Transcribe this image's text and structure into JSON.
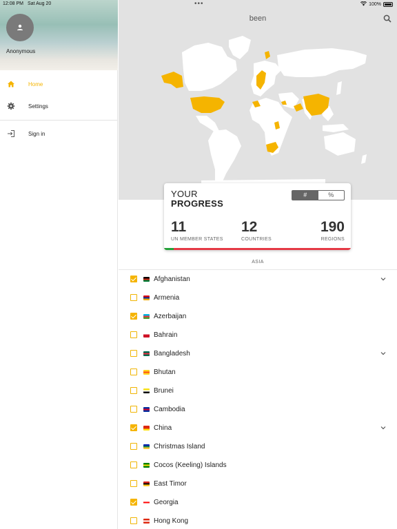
{
  "status": {
    "time": "12:08 PM",
    "date": "Sat Aug 20",
    "battery": "100%"
  },
  "sidebar": {
    "user_name": "Anonymous",
    "items": [
      {
        "label": "Home",
        "icon": "home-icon"
      },
      {
        "label": "Settings",
        "icon": "gear-icon"
      },
      {
        "label": "Sign in",
        "icon": "sign-in-icon"
      }
    ]
  },
  "app": {
    "title": "been"
  },
  "progress": {
    "title_line1": "YOUR",
    "title_line2": "PROGRESS",
    "toggle": {
      "count_label": "#",
      "percent_label": "%",
      "selected": "#"
    },
    "stats": [
      {
        "value": "11",
        "label": "UN MEMBER STATES"
      },
      {
        "value": "12",
        "label": "COUNTRIES"
      },
      {
        "value": "190",
        "label": "REGIONS"
      }
    ],
    "bar_fill_fraction": 0.05
  },
  "section": {
    "title": "ASIA"
  },
  "countries": [
    {
      "name": "Afghanistan",
      "checked": true,
      "expandable": true
    },
    {
      "name": "Armenia",
      "checked": false,
      "expandable": false
    },
    {
      "name": "Azerbaijan",
      "checked": true,
      "expandable": false
    },
    {
      "name": "Bahrain",
      "checked": false,
      "expandable": false
    },
    {
      "name": "Bangladesh",
      "checked": false,
      "expandable": true
    },
    {
      "name": "Bhutan",
      "checked": false,
      "expandable": false
    },
    {
      "name": "Brunei",
      "checked": false,
      "expandable": false
    },
    {
      "name": "Cambodia",
      "checked": false,
      "expandable": false
    },
    {
      "name": "China",
      "checked": true,
      "expandable": true
    },
    {
      "name": "Christmas Island",
      "checked": false,
      "expandable": false
    },
    {
      "name": "Cocos (Keeling) Islands",
      "checked": false,
      "expandable": false
    },
    {
      "name": "East Timor",
      "checked": false,
      "expandable": false
    },
    {
      "name": "Georgia",
      "checked": true,
      "expandable": false
    },
    {
      "name": "Hong Kong",
      "checked": false,
      "expandable": false
    }
  ],
  "colors": {
    "accent": "#f5b400",
    "visited_country": "#f5b400",
    "land": "#ffffff",
    "ocean": "#e2e2e2",
    "progress_done": "#23a339",
    "progress_remaining": "#e53945"
  }
}
